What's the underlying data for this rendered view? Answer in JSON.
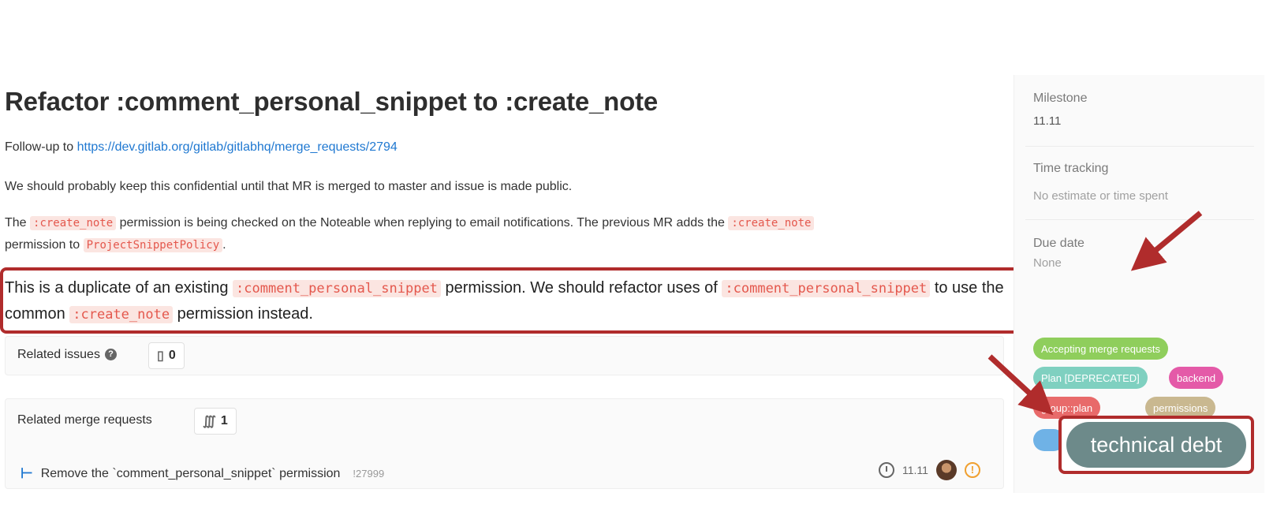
{
  "issue": {
    "title": "Refactor :comment_personal_snippet to :create_note",
    "followup_prefix": "Follow-up to ",
    "followup_link": "https://dev.gitlab.org/gitlab/gitlabhq/merge_requests/2794",
    "confidential_note": "We should probably keep this confidential until that MR is merged to master and issue is made public.",
    "para3": {
      "t1": "The ",
      "code1": ":create_note",
      "t2": " permission is being checked on the Noteable when replying to email notifications. The previous MR adds the ",
      "code2": ":create_note",
      "t3": "permission to ",
      "code3": "ProjectSnippetPolicy",
      "t4": "."
    },
    "highlight": {
      "t1": "This is a duplicate of an existing ",
      "code1": ":comment_personal_snippet",
      "t2": " permission. We should refactor uses of ",
      "code2": ":comment_personal_snippet",
      "t3": " to use the",
      "t4": "common ",
      "code3": ":create_note",
      "t5": " permission instead."
    }
  },
  "related_issues": {
    "label": "Related issues",
    "help_icon": "question-icon",
    "count_icon": "issue-icon",
    "count": "0"
  },
  "related_mrs": {
    "label": "Related merge requests",
    "count_icon": "merge-request-icon",
    "count": "1",
    "items": [
      {
        "title": "Remove the `comment_personal_snippet` permission",
        "ref": "!27999",
        "milestone": "11.11",
        "status_icon": "warning-icon"
      }
    ]
  },
  "sidebar": {
    "milestone_label": "Milestone",
    "milestone_value": "11.11",
    "time_label": "Time tracking",
    "time_value": "No estimate or time spent",
    "due_label": "Due date",
    "due_value": "None",
    "labels": [
      {
        "text": "Accepting merge requests",
        "color": "#8fce5c"
      },
      {
        "text": "Plan [DEPRECATED]",
        "color": "#7fd0c0"
      },
      {
        "text": "backend",
        "color": "#e45aa8"
      },
      {
        "text": "group::plan",
        "color": "#e86a6a"
      },
      {
        "text": "permissions",
        "color": "#c9b890"
      },
      {
        "text": "technical debt",
        "color": "#6d8a8a"
      }
    ]
  },
  "annotation_color": "#b02c2c"
}
